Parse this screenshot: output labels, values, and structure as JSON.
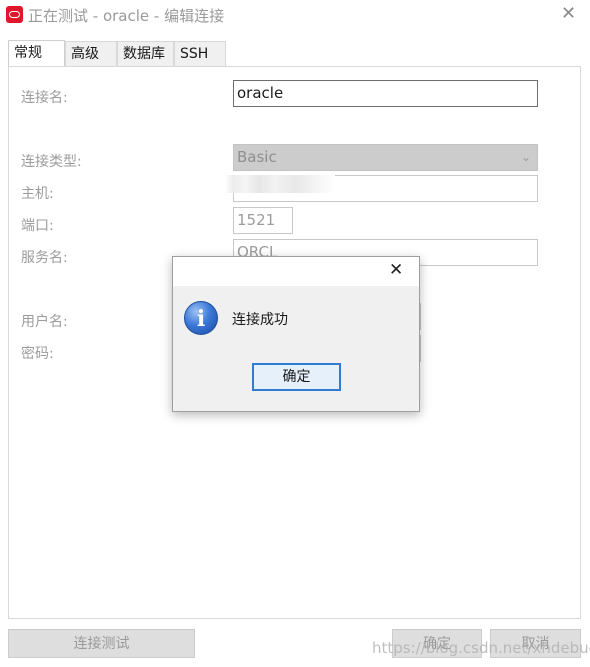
{
  "window": {
    "title": "正在测试 - oracle - 编辑连接",
    "close_glyph": "✕"
  },
  "tabs": [
    {
      "label": "常规",
      "active": true
    },
    {
      "label": "高级",
      "active": false
    },
    {
      "label": "数据库",
      "active": false
    },
    {
      "label": "SSH",
      "active": false
    }
  ],
  "form": {
    "connection_name_label": "连接名:",
    "connection_name_value": "oracle",
    "connection_type_label": "连接类型:",
    "connection_type_value": "Basic",
    "host_label": "主机:",
    "host_value": "",
    "port_label": "端口:",
    "port_value": "1521",
    "service_name_label": "服务名:",
    "service_name_value": "ORCL",
    "username_label": "用户名:",
    "password_label": "密码:"
  },
  "buttons": {
    "test_connection": "连接测试",
    "ok": "确定",
    "cancel": "取消"
  },
  "dialog": {
    "message": "连接成功",
    "ok": "确定",
    "close_glyph": "✕",
    "icon_glyph": "i"
  },
  "watermark": "https://blog.csdn.net/xhdebug",
  "colors": {
    "accent": "#2f7bd8",
    "app_icon": "#e0162b"
  }
}
